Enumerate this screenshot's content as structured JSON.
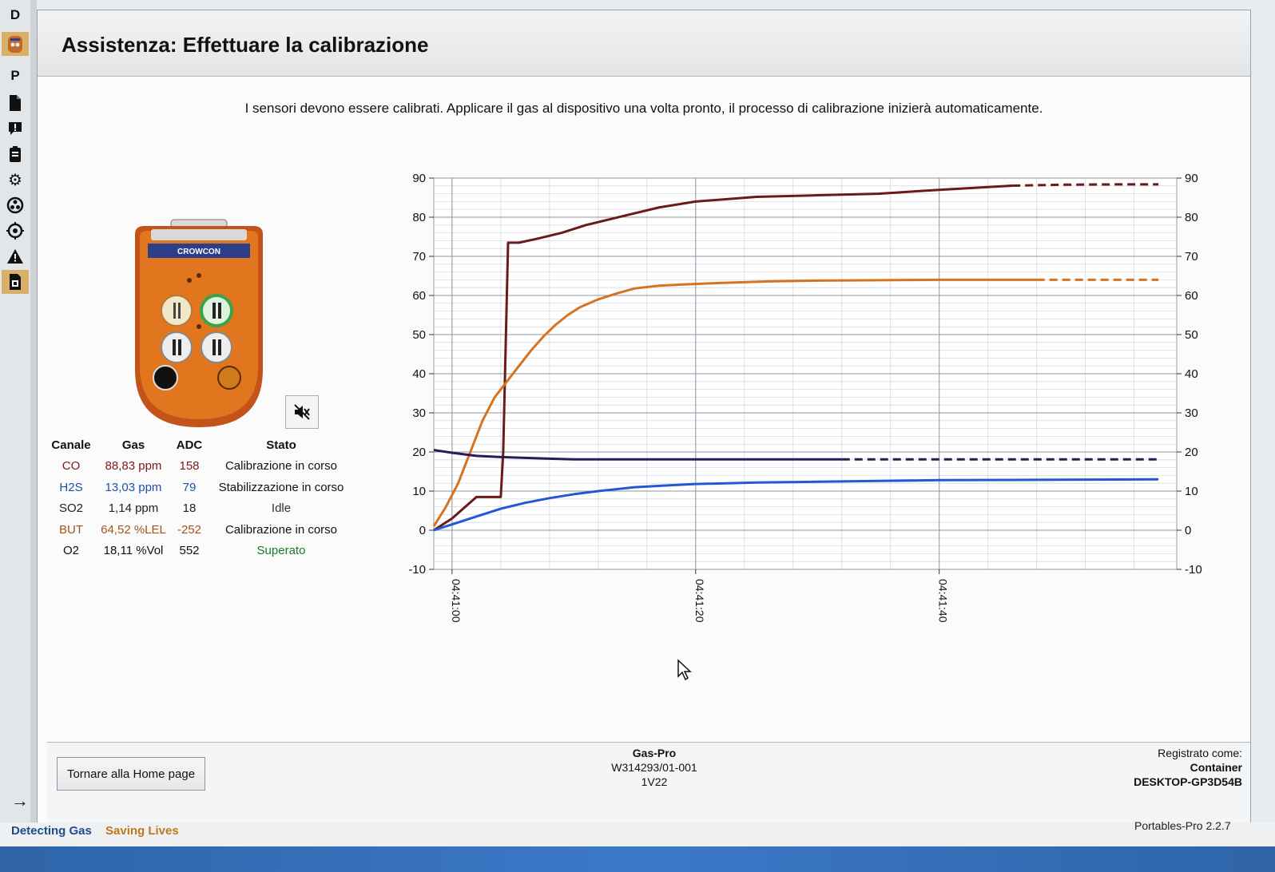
{
  "toolbar": {
    "items": [
      {
        "label": "D",
        "icon": "letter-d"
      },
      {
        "label": "",
        "icon": "device-icon"
      },
      {
        "label": "P",
        "icon": "letter-p"
      },
      {
        "label": "",
        "icon": "document-icon"
      },
      {
        "label": "",
        "icon": "alert-message-icon"
      },
      {
        "label": "",
        "icon": "clipboard-icon"
      },
      {
        "label": "",
        "icon": "gear-icon"
      },
      {
        "label": "",
        "icon": "hazard-icon"
      },
      {
        "label": "",
        "icon": "target-icon"
      },
      {
        "label": "",
        "icon": "warning-icon"
      },
      {
        "label": "",
        "icon": "calibration-icon"
      }
    ]
  },
  "header": {
    "title": "Assistenza: Effettuare la calibrazione"
  },
  "instruction": "I sensori devono essere calibrati. Applicare il gas al dispositivo una volta pronto, il processo di calibrazione inizierà automaticamente.",
  "device": {
    "brand": "CROWCON"
  },
  "channel_table": {
    "headers": [
      "Canale",
      "Gas",
      "ADC",
      "Stato"
    ],
    "rows": [
      {
        "channel": "CO",
        "gas": "88,83 ppm",
        "adc": "158",
        "status": "Calibrazione in corso",
        "color": "#7a1a1a",
        "status_color": "#111111"
      },
      {
        "channel": "H2S",
        "gas": "13,03 ppm",
        "adc": "79",
        "status": "Stabilizzazione in corso",
        "color": "#1f4fa8",
        "status_color": "#111111"
      },
      {
        "channel": "SO2",
        "gas": "1,14 ppm",
        "adc": "18",
        "status": "Idle",
        "color": "#222222",
        "status_color": "#333333"
      },
      {
        "channel": "BUT",
        "gas": "64,52 %LEL",
        "adc": "-252",
        "status": "Calibrazione in corso",
        "color": "#a5531a",
        "status_color": "#111111"
      },
      {
        "channel": "O2",
        "gas": "18,11 %Vol",
        "adc": "552",
        "status": "Superato",
        "color": "#111111",
        "status_color": "#1a7a2a"
      }
    ]
  },
  "chart_data": {
    "type": "line",
    "ylim": [
      -10,
      90
    ],
    "y_ticks": [
      -10,
      0,
      10,
      20,
      30,
      40,
      50,
      60,
      70,
      80,
      90
    ],
    "x_ticks": [
      "04:41:00",
      "04:41:20",
      "04:41:40"
    ],
    "xlim_seconds": [
      -1.5,
      59.5
    ],
    "grid": true,
    "series": [
      {
        "color": "#6b1a1a",
        "dash_from": 46,
        "x": [
          -1.5,
          0,
          2,
          4,
          4.2,
          4.6,
          5.5,
          7,
          9,
          11,
          13,
          15,
          17,
          20,
          25,
          30,
          35,
          40,
          45,
          50,
          55,
          58
        ],
        "y": [
          0,
          3,
          8.5,
          8.5,
          20,
          73.5,
          73.5,
          74.5,
          76,
          78,
          79.5,
          81,
          82.5,
          84,
          85.2,
          85.6,
          86,
          87,
          88,
          88.3,
          88.4,
          88.4
        ]
      },
      {
        "color": "#d5731f",
        "dash_from": 48,
        "x": [
          -1.5,
          -0.5,
          0.5,
          1.5,
          2.5,
          3.5,
          4.5,
          5.5,
          6.5,
          7.5,
          8.5,
          9.5,
          10.5,
          12,
          13.5,
          15,
          17,
          19,
          22,
          26,
          30,
          35,
          40,
          45,
          50,
          55,
          58
        ],
        "y": [
          1,
          6,
          12,
          20,
          28,
          34,
          38,
          42,
          46,
          49.5,
          52.5,
          55,
          57,
          59,
          60.5,
          61.8,
          62.5,
          62.8,
          63.2,
          63.6,
          63.8,
          63.9,
          64,
          64,
          64,
          64,
          64
        ]
      },
      {
        "color": "#2a1a55",
        "dash_from": 32,
        "x": [
          -1.5,
          0,
          2,
          4,
          6,
          8,
          10,
          15,
          20,
          30,
          40,
          50,
          58
        ],
        "y": [
          20.5,
          19.8,
          19,
          18.7,
          18.5,
          18.3,
          18.1,
          18.1,
          18.1,
          18.1,
          18.1,
          18.1,
          18.1
        ]
      },
      {
        "color": "#2456d6",
        "dash_from": null,
        "x": [
          -1.5,
          0,
          2,
          4,
          6,
          8,
          10,
          12,
          15,
          18,
          20,
          25,
          30,
          35,
          40,
          50,
          58
        ],
        "y": [
          0,
          1.5,
          3.5,
          5.5,
          7,
          8.2,
          9.2,
          10,
          11,
          11.5,
          11.8,
          12.2,
          12.4,
          12.6,
          12.8,
          12.9,
          13
        ]
      }
    ]
  },
  "bottom": {
    "home_button": "Tornare alla Home page",
    "device_name": "Gas-Pro",
    "serial": "W314293/01-001",
    "firmware": "1V22",
    "registered_label": "Registrato come:",
    "registered_role": "Container",
    "registered_host": "DESKTOP-GP3D54B"
  },
  "footer": {
    "tagline_1": "Detecting Gas",
    "tagline_2": "Saving Lives",
    "version": "Portables-Pro 2.2.7",
    "arrow": "→"
  },
  "colors": {
    "accent": "#d9b06a",
    "brand_blue": "#1d4d8c",
    "brand_orange": "#c0771c"
  }
}
